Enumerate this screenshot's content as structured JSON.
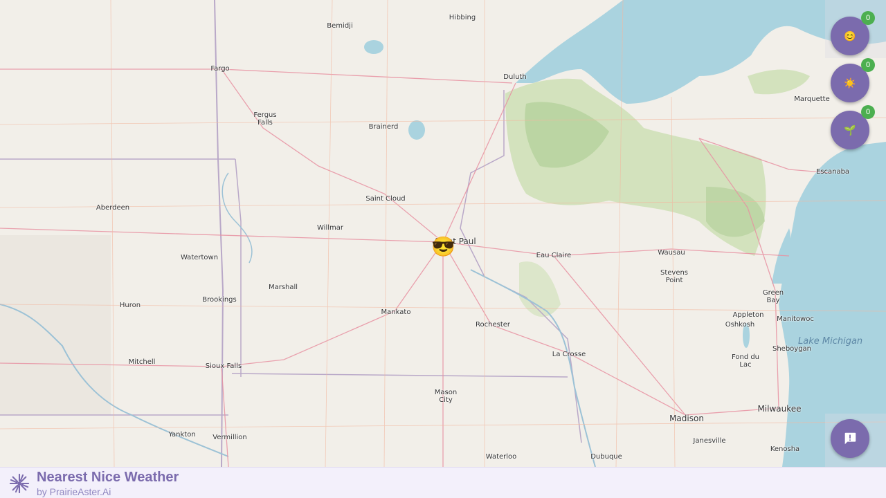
{
  "app": {
    "title": "Nearest Nice Weather",
    "subtitle": "by PrairieAster.Ai"
  },
  "map": {
    "lake_label": "Lake Michigan",
    "user_marker_emoji": "😎",
    "cities": [
      {
        "name": "Hibbing"
      },
      {
        "name": "Bemidji"
      },
      {
        "name": "Fargo"
      },
      {
        "name": "Duluth"
      },
      {
        "name": "Marquette"
      },
      {
        "name": "Fergus\nFalls"
      },
      {
        "name": "Brainerd"
      },
      {
        "name": "Escanaba"
      },
      {
        "name": "Saint Cloud"
      },
      {
        "name": "Aberdeen"
      },
      {
        "name": "Willmar"
      },
      {
        "name": "Saint Paul"
      },
      {
        "name": "Eau Claire"
      },
      {
        "name": "Wausau"
      },
      {
        "name": "Watertown"
      },
      {
        "name": "Stevens\nPoint"
      },
      {
        "name": "Marshall"
      },
      {
        "name": "Green\nBay"
      },
      {
        "name": "Huron"
      },
      {
        "name": "Brookings"
      },
      {
        "name": "Mankato"
      },
      {
        "name": "Appleton"
      },
      {
        "name": "Manitowoc"
      },
      {
        "name": "Rochester"
      },
      {
        "name": "Oshkosh"
      },
      {
        "name": "Sheboygan"
      },
      {
        "name": "La Crosse"
      },
      {
        "name": "Fond du\nLac"
      },
      {
        "name": "Mitchell"
      },
      {
        "name": "Sioux Falls"
      },
      {
        "name": "Mason\nCity"
      },
      {
        "name": "Milwaukee"
      },
      {
        "name": "Madison"
      },
      {
        "name": "Yankton"
      },
      {
        "name": "Vermillion"
      },
      {
        "name": "Janesville"
      },
      {
        "name": "Waterloo"
      },
      {
        "name": "Dubuque"
      },
      {
        "name": "Kenosha"
      }
    ]
  },
  "filters": [
    {
      "icon": "smile-emoji-icon",
      "glyph": "😊",
      "count": "0"
    },
    {
      "icon": "sun-emoji-icon",
      "glyph": "☀️",
      "count": "0"
    },
    {
      "icon": "seedling-emoji-icon",
      "glyph": "🌱",
      "count": "0"
    }
  ],
  "feedback": {
    "icon": "feedback-icon"
  },
  "colors": {
    "accent": "#7b6bad",
    "badge": "#4caf50",
    "water": "#aad3df",
    "forest": "#aed09a",
    "land": "#f2efe9"
  }
}
